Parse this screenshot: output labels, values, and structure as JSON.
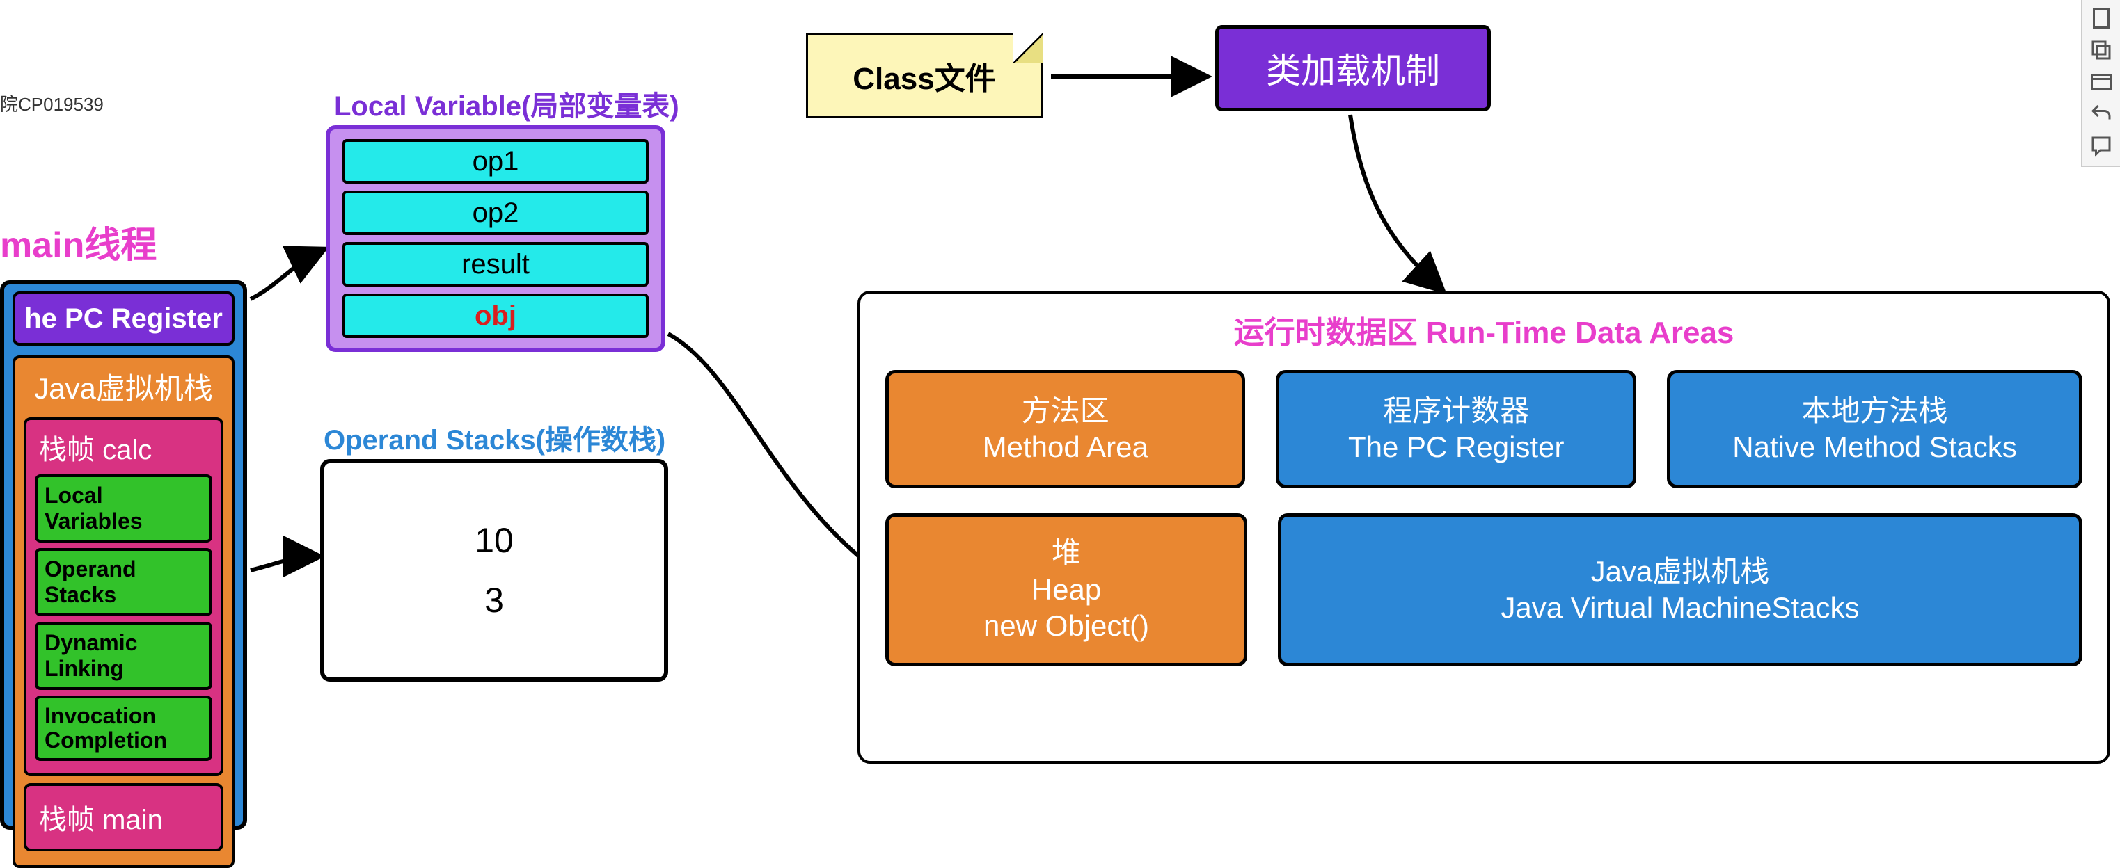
{
  "watermark": "院CP019539",
  "main_thread_title": "main线程",
  "thread": {
    "pc_register": "he PC Register",
    "jvm_stack_title": "Java虚拟机栈",
    "frame_calc": {
      "title": "栈帧  calc",
      "subs": [
        "Local Variables",
        "Operand Stacks",
        "Dynamic Linking",
        "Invocation Completion"
      ]
    },
    "frame_main": {
      "title": "栈帧  main"
    }
  },
  "lvt": {
    "title": "Local Variable(局部变量表)",
    "cells": [
      "op1",
      "op2",
      "result",
      "obj"
    ]
  },
  "ops": {
    "title": "Operand Stacks(操作数栈)",
    "values": [
      "10",
      "3"
    ]
  },
  "note": "Class文件",
  "loader": "类加载机制",
  "rtda": {
    "title": "运行时数据区 Run-Time Data Areas",
    "method_area": {
      "l1": "方法区",
      "l2": "Method Area"
    },
    "pc": {
      "l1": "程序计数器",
      "l2": "The PC Register"
    },
    "native": {
      "l1": "本地方法栈",
      "l2": "Native Method Stacks"
    },
    "heap": {
      "l1": "堆",
      "l2": "Heap",
      "l3": "new Object()"
    },
    "jvm": {
      "l1": "Java虚拟机栈",
      "l2": "Java Virtual MachineStacks"
    }
  },
  "toolbar_icons": [
    "page-icon",
    "copy-icon",
    "window-icon",
    "undo-icon",
    "comment-icon"
  ]
}
